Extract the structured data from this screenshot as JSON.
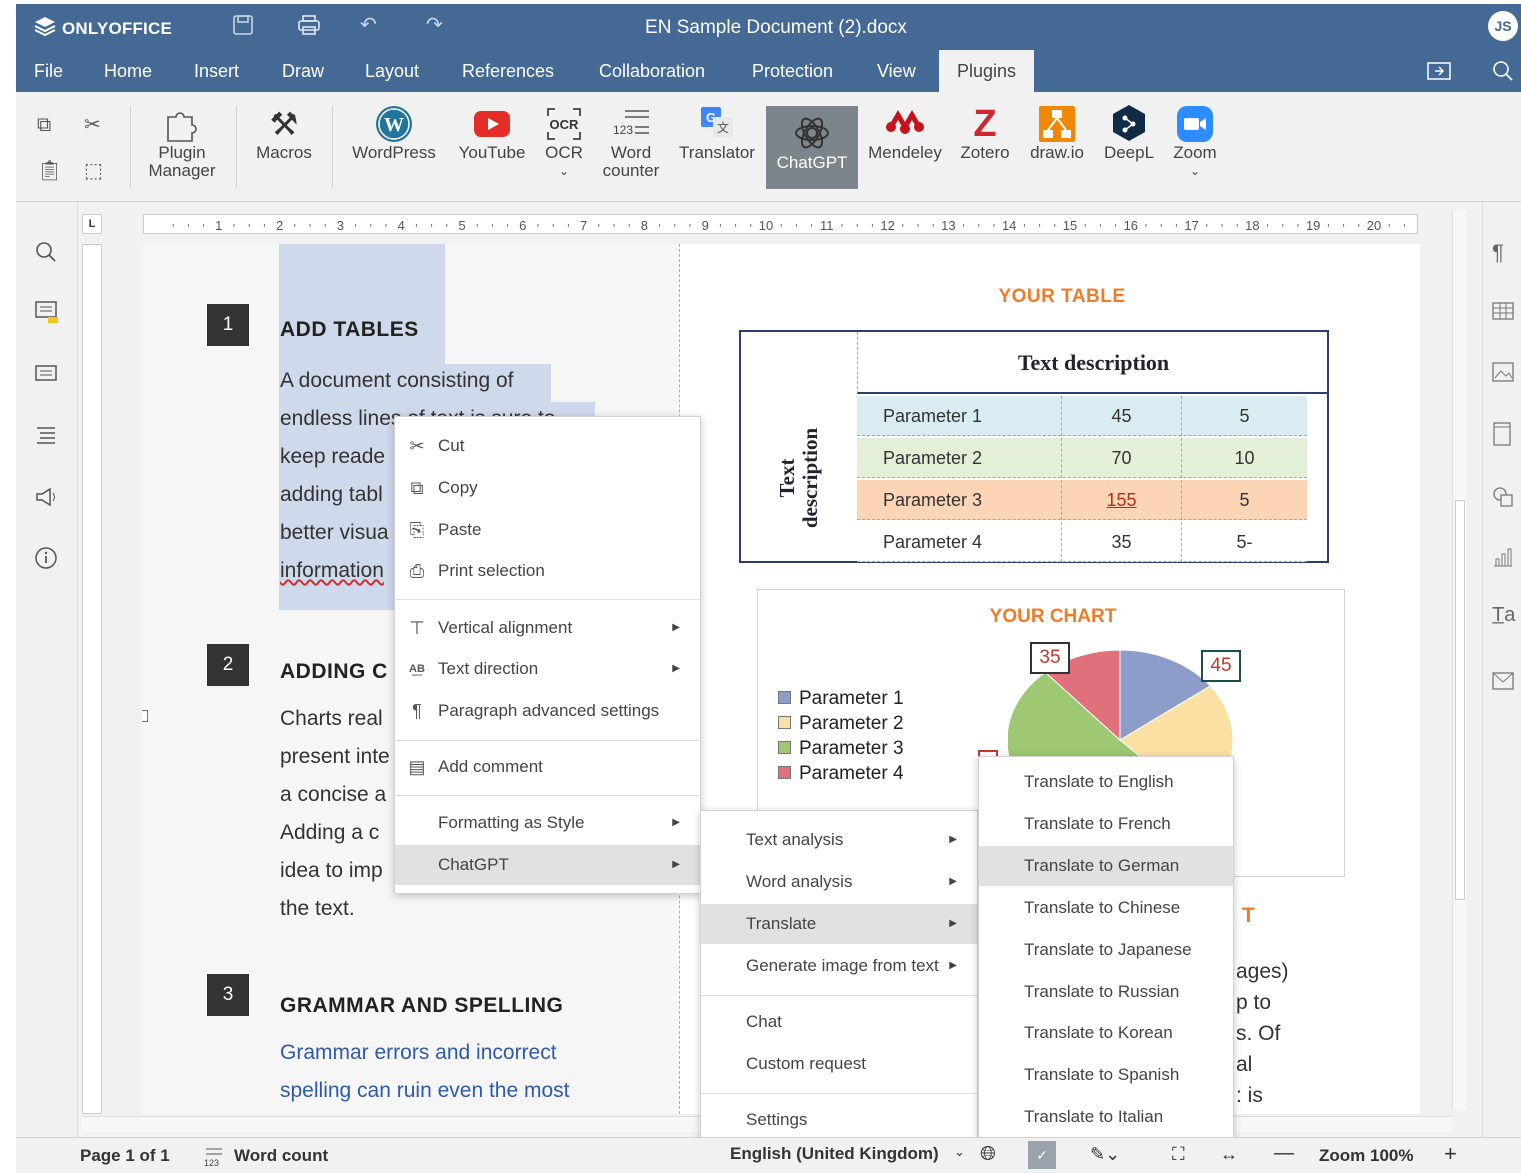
{
  "app": {
    "brand": "ONLYOFFICE",
    "doc_title": "EN Sample Document (2).docx",
    "avatar": "JS"
  },
  "menu": {
    "tabs": [
      "File",
      "Home",
      "Insert",
      "Draw",
      "Layout",
      "References",
      "Collaboration",
      "Protection",
      "View",
      "Plugins"
    ],
    "active": "Plugins"
  },
  "toolbar": {
    "plugin_manager": [
      "Plugin",
      "Manager"
    ],
    "macros": "Macros",
    "wordpress": "WordPress",
    "youtube": "YouTube",
    "ocr": "OCR",
    "word_counter": [
      "Word",
      "counter"
    ],
    "translator": "Translator",
    "chatgpt": "ChatGPT",
    "mendeley": "Mendeley",
    "zotero": "Zotero",
    "drawio": "draw.io",
    "deepl": "DeepL",
    "zoom": "Zoom"
  },
  "ruler": {
    "marks": [
      "1",
      "2",
      "3",
      "4",
      "5",
      "6",
      "7",
      "8",
      "9",
      "10",
      "11",
      "12",
      "13",
      "14",
      "15",
      "16",
      "17",
      "18",
      "19",
      "20"
    ],
    "corner": "L"
  },
  "document": {
    "sections": [
      {
        "num": "1",
        "heading": "ADD TABLES",
        "lines": [
          "A document consisting of",
          "endless lines of text is sure to",
          "keep reade",
          "adding tabl",
          "better visua",
          "information"
        ]
      },
      {
        "num": "2",
        "heading": "ADDING C",
        "lines": [
          "Charts real",
          "present inte",
          "a concise a",
          "Adding a c",
          "idea to imp",
          "the text."
        ]
      },
      {
        "num": "3",
        "heading": "GRAMMAR AND SPELLING",
        "lines": [
          "Grammar errors and incorrect",
          "spelling can ruin even the most"
        ]
      }
    ],
    "table_title": "YOUR TABLE",
    "table_header": "Text description",
    "table_side": "Text description",
    "table_rows": [
      {
        "name": "Parameter 1",
        "v1": "45",
        "v2": "5",
        "color": "#d9ecf2"
      },
      {
        "name": "Parameter 2",
        "v1": "70",
        "v2": "10",
        "color": "#e3efd6"
      },
      {
        "name": "Parameter 3",
        "v1": "155",
        "v2": "5",
        "color": "#fbd5b5"
      },
      {
        "name": "Parameter 4",
        "v1": "35",
        "v2": "5-",
        "color": "#ffffff"
      }
    ],
    "chart_title": "YOUR CHART",
    "chart_labels": {
      "a": "35",
      "b": "45"
    },
    "right_text": [
      "ages)",
      "p to",
      "s. Of",
      "al",
      ": is"
    ],
    "right_heading_frag": "T"
  },
  "chart_data": {
    "type": "pie",
    "title": "YOUR CHART",
    "categories": [
      "Parameter 1",
      "Parameter 2",
      "Parameter 3",
      "Parameter 4"
    ],
    "values": [
      45,
      70,
      155,
      35
    ],
    "colors": [
      "#8c9dc9",
      "#fbe0a4",
      "#9ec873",
      "#e0707a"
    ]
  },
  "context_menu": {
    "items": [
      "Cut",
      "Copy",
      "Paste",
      "Print selection",
      "Vertical alignment",
      "Text direction",
      "Paragraph advanced settings",
      "Add comment",
      "Formatting as Style",
      "ChatGPT"
    ]
  },
  "chatgpt_menu": {
    "items": [
      "Text analysis",
      "Word analysis",
      "Translate",
      "Generate image from text",
      "Chat",
      "Custom request",
      "Settings"
    ]
  },
  "translate_menu": {
    "items": [
      "Translate to English",
      "Translate to French",
      "Translate to German",
      "Translate to Chinese",
      "Translate to Japanese",
      "Translate to Russian",
      "Translate to Korean",
      "Translate to Spanish",
      "Translate to Italian"
    ]
  },
  "status": {
    "page": "Page 1 of 1",
    "word_count": "Word count",
    "language": "English (United Kingdom)",
    "zoom": "Zoom 100%"
  }
}
